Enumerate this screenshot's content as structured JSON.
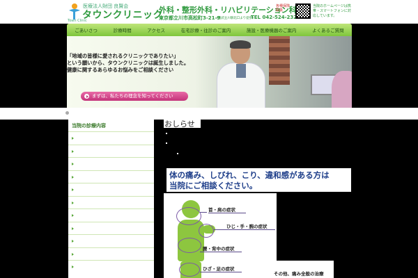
{
  "header": {
    "logo_sub": "医療法人財団 良賢会",
    "logo_name": "タウンクリニック",
    "logo_en": "Town Clinic",
    "specialties": "外科・整形外科・リハビリテーション科",
    "badge": "各種保険取扱",
    "address": "東京都立川市高松町3-21-9",
    "station": "(西武立川駅北口より徒歩)",
    "tel": "TEL 042-524-2321",
    "mobile_note": "当院のホームページは携帯・スマートフォンに対応しています。"
  },
  "nav": {
    "items": [
      {
        "label": "ごあいさつ"
      },
      {
        "label": "診療時間"
      },
      {
        "label": "アクセス"
      },
      {
        "label": "在宅診療・往診のご案内"
      },
      {
        "label": "施設・医療機器のご案内"
      },
      {
        "label": "よくあるご質問"
      }
    ]
  },
  "hero": {
    "line1": "「地域の皆様に愛されるクリニックでありたい」",
    "line2": "という願いから、タウンクリニックは誕生しました。",
    "line3": "健康に関するあらゆるお悩みをご相談ください",
    "cta": "まずは、私たちの理念を知ってください"
  },
  "sidebar": {
    "title": "当院の診療内容",
    "item_count": 11
  },
  "news": {
    "title": "おしらせ"
  },
  "info": {
    "line1": "体の痛み、しびれ、こり、違和感がある方は",
    "line2": "当院にご相談ください。"
  },
  "symptoms": {
    "items": [
      {
        "label": "首・肩の症状"
      },
      {
        "label": "ひじ・手・腕の症状"
      },
      {
        "label": "腰・背中の症状"
      },
      {
        "label": "ひざ・足の症状"
      }
    ],
    "extra": "その他、痛み全般の治療"
  }
}
